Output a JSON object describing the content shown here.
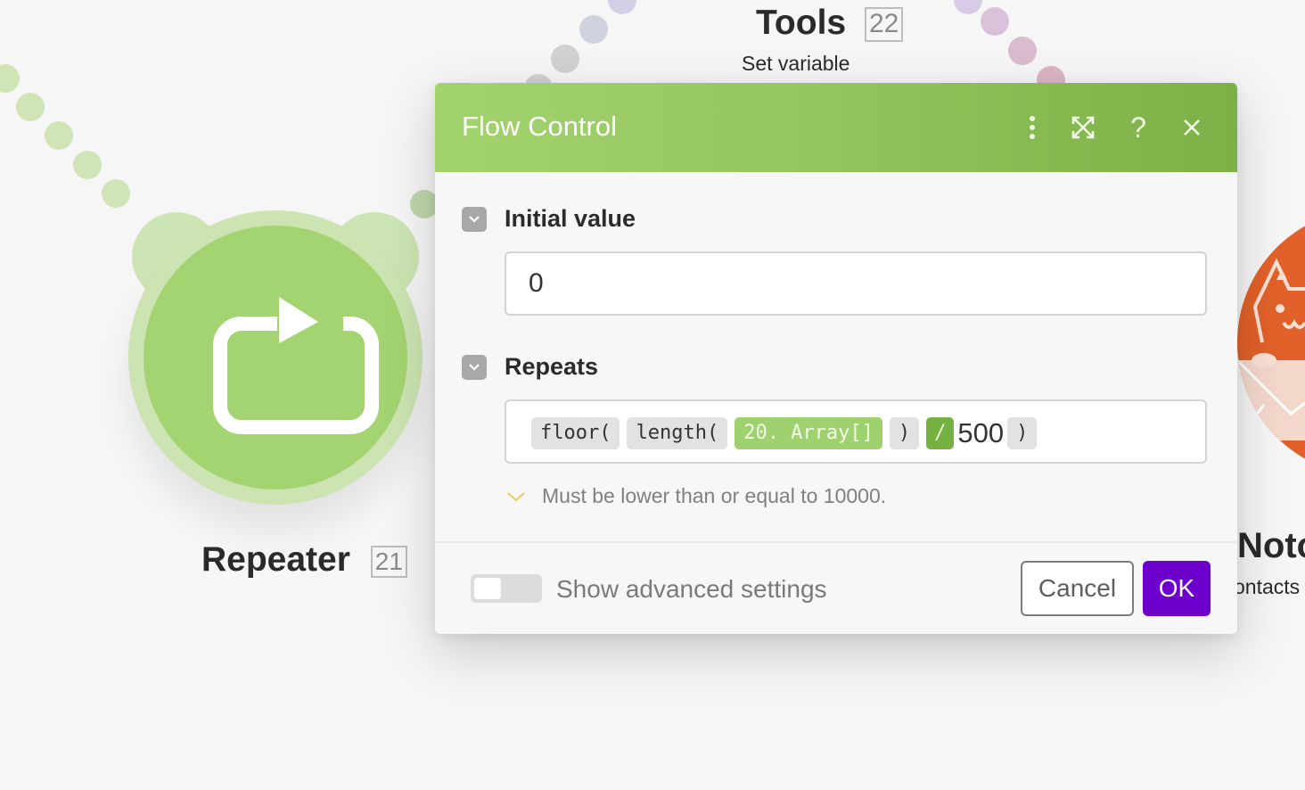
{
  "canvas": {
    "modules": [
      {
        "name": "Tools",
        "id_badge": "22",
        "subtitle": "Set variable"
      },
      {
        "name": "Repeater",
        "id_badge": "21"
      },
      {
        "name": "Noto",
        "subtitle": "ontacts"
      }
    ]
  },
  "dialog": {
    "title": "Flow Control",
    "header_icons": [
      "more-vertical-icon",
      "expand-icon",
      "help-icon",
      "close-icon"
    ],
    "fields": [
      {
        "label": "Initial value",
        "value": "0"
      },
      {
        "label": "Repeats",
        "tokens": [
          {
            "type": "function",
            "text": "floor("
          },
          {
            "type": "function",
            "text": "length("
          },
          {
            "type": "variable",
            "text": "20. Array[]"
          },
          {
            "type": "function",
            "text": ")"
          },
          {
            "type": "operator",
            "text": "/"
          },
          {
            "type": "plain",
            "text": "500"
          },
          {
            "type": "function",
            "text": ")"
          }
        ],
        "hint": "Must be lower than or equal to 10000."
      }
    ],
    "footer": {
      "toggle_label": "Show advanced settings",
      "toggle_on": false,
      "cancel_label": "Cancel",
      "ok_label": "OK"
    }
  },
  "colors": {
    "header_green": "#93c45e",
    "ok_purple": "#6d00cc",
    "repeater_green": "#a3d471",
    "right_module_orange": "#e2612a"
  }
}
